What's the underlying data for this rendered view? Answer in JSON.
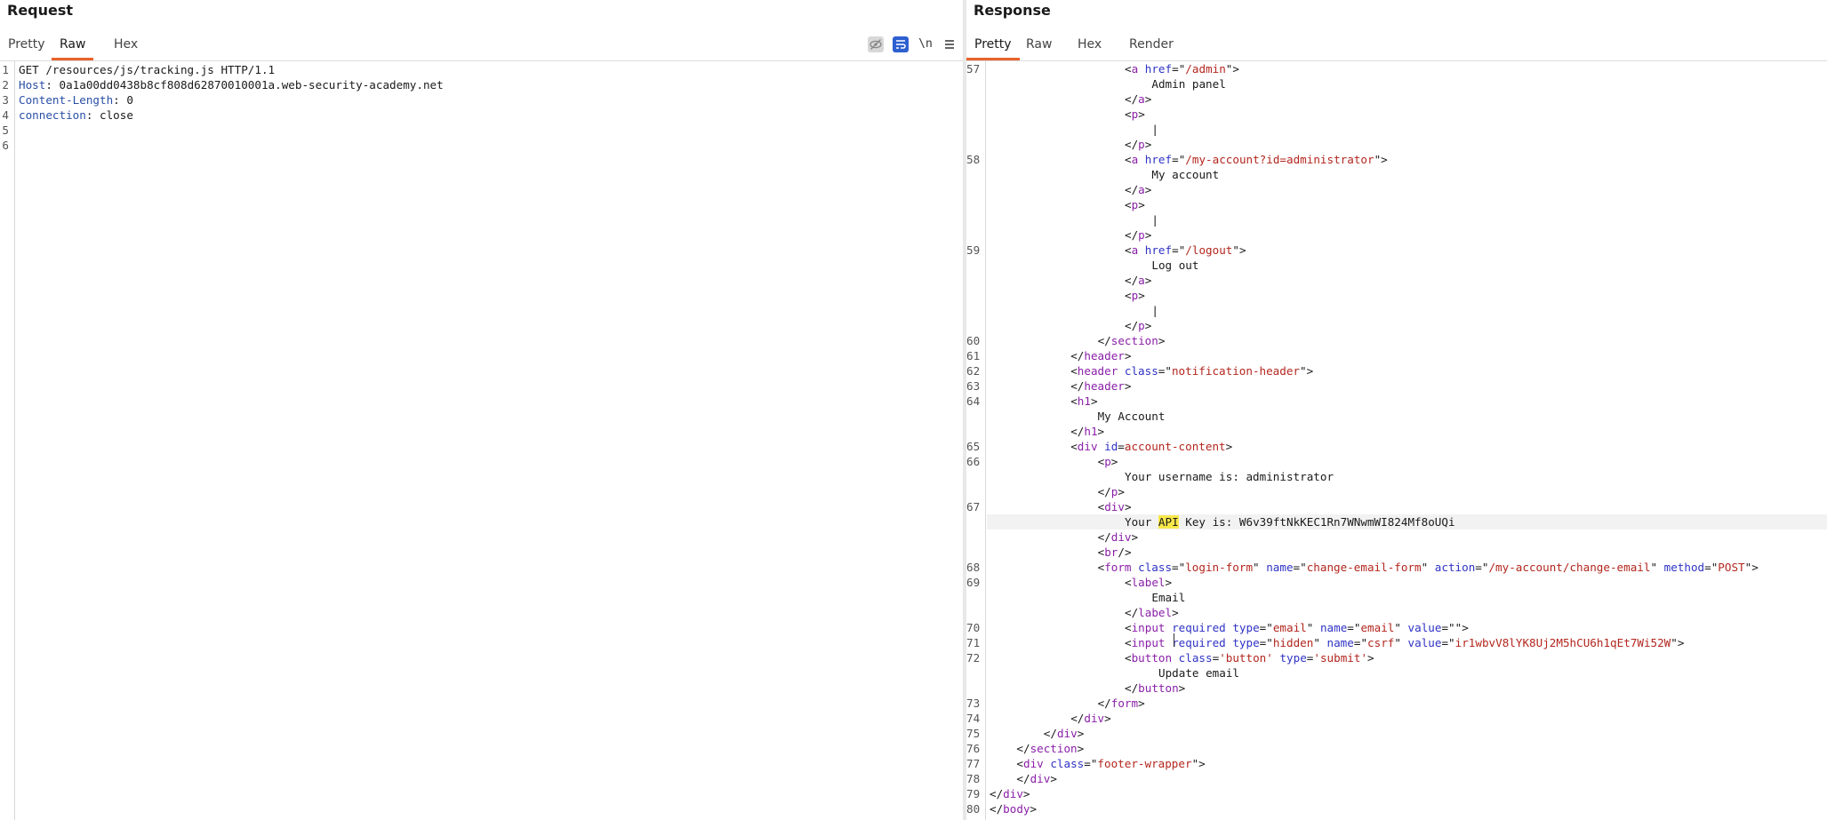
{
  "request": {
    "title": "Request",
    "tabs": [
      "Pretty",
      "Raw",
      "Hex"
    ],
    "active_tab": "Raw",
    "toolbar": {
      "hide_icon": "eye-slash-icon",
      "wrap_icon": "word-wrap-icon",
      "newline_label": "\\n",
      "menu_icon": "hamburger-menu-icon"
    },
    "lines": [
      {
        "n": "1",
        "tokens": [
          {
            "t": "GET /resources/js/tracking.js HTTP/1.1",
            "c": "plain"
          }
        ]
      },
      {
        "n": "2",
        "tokens": [
          {
            "t": "Host",
            "c": "hname"
          },
          {
            "t": ": 0a1a00dd0438b8cf808d62870010001a.web-security-academy.net",
            "c": "plain"
          }
        ]
      },
      {
        "n": "3",
        "tokens": [
          {
            "t": "Content-Length",
            "c": "hname"
          },
          {
            "t": ": 0",
            "c": "plain"
          }
        ]
      },
      {
        "n": "4",
        "tokens": [
          {
            "t": "connection",
            "c": "hname"
          },
          {
            "t": ": close",
            "c": "plain"
          }
        ]
      },
      {
        "n": "5",
        "tokens": []
      },
      {
        "n": "6",
        "tokens": []
      }
    ]
  },
  "response": {
    "title": "Response",
    "tabs": [
      "Pretty",
      "Raw",
      "Hex",
      "Render"
    ],
    "active_tab": "Pretty",
    "lines": [
      {
        "n": "57",
        "i": 20,
        "tokens": [
          {
            "t": "<",
            "c": "punc"
          },
          {
            "t": "a",
            "c": "tag"
          },
          {
            "t": " href",
            "c": "attr"
          },
          {
            "t": "=\"",
            "c": "punc"
          },
          {
            "t": "/admin",
            "c": "val"
          },
          {
            "t": "\">",
            "c": "punc"
          }
        ]
      },
      {
        "n": "",
        "i": 24,
        "tokens": [
          {
            "t": "Admin panel",
            "c": "plain"
          }
        ]
      },
      {
        "n": "",
        "i": 20,
        "tokens": [
          {
            "t": "</",
            "c": "punc"
          },
          {
            "t": "a",
            "c": "tag"
          },
          {
            "t": ">",
            "c": "punc"
          }
        ]
      },
      {
        "n": "",
        "i": 20,
        "tokens": [
          {
            "t": "<",
            "c": "punc"
          },
          {
            "t": "p",
            "c": "tag"
          },
          {
            "t": ">",
            "c": "punc"
          }
        ]
      },
      {
        "n": "",
        "i": 24,
        "tokens": [
          {
            "t": "|",
            "c": "plain"
          }
        ]
      },
      {
        "n": "",
        "i": 20,
        "tokens": [
          {
            "t": "</",
            "c": "punc"
          },
          {
            "t": "p",
            "c": "tag"
          },
          {
            "t": ">",
            "c": "punc"
          }
        ]
      },
      {
        "n": "58",
        "i": 20,
        "tokens": [
          {
            "t": "<",
            "c": "punc"
          },
          {
            "t": "a",
            "c": "tag"
          },
          {
            "t": " href",
            "c": "attr"
          },
          {
            "t": "=\"",
            "c": "punc"
          },
          {
            "t": "/my-account?id=administrator",
            "c": "val"
          },
          {
            "t": "\">",
            "c": "punc"
          }
        ]
      },
      {
        "n": "",
        "i": 24,
        "tokens": [
          {
            "t": "My account",
            "c": "plain"
          }
        ]
      },
      {
        "n": "",
        "i": 20,
        "tokens": [
          {
            "t": "</",
            "c": "punc"
          },
          {
            "t": "a",
            "c": "tag"
          },
          {
            "t": ">",
            "c": "punc"
          }
        ]
      },
      {
        "n": "",
        "i": 20,
        "tokens": [
          {
            "t": "<",
            "c": "punc"
          },
          {
            "t": "p",
            "c": "tag"
          },
          {
            "t": ">",
            "c": "punc"
          }
        ]
      },
      {
        "n": "",
        "i": 24,
        "tokens": [
          {
            "t": "|",
            "c": "plain"
          }
        ]
      },
      {
        "n": "",
        "i": 20,
        "tokens": [
          {
            "t": "</",
            "c": "punc"
          },
          {
            "t": "p",
            "c": "tag"
          },
          {
            "t": ">",
            "c": "punc"
          }
        ]
      },
      {
        "n": "59",
        "i": 20,
        "tokens": [
          {
            "t": "<",
            "c": "punc"
          },
          {
            "t": "a",
            "c": "tag"
          },
          {
            "t": " href",
            "c": "attr"
          },
          {
            "t": "=\"",
            "c": "punc"
          },
          {
            "t": "/logout",
            "c": "val"
          },
          {
            "t": "\">",
            "c": "punc"
          }
        ]
      },
      {
        "n": "",
        "i": 24,
        "tokens": [
          {
            "t": "Log out",
            "c": "plain"
          }
        ]
      },
      {
        "n": "",
        "i": 20,
        "tokens": [
          {
            "t": "</",
            "c": "punc"
          },
          {
            "t": "a",
            "c": "tag"
          },
          {
            "t": ">",
            "c": "punc"
          }
        ]
      },
      {
        "n": "",
        "i": 20,
        "tokens": [
          {
            "t": "<",
            "c": "punc"
          },
          {
            "t": "p",
            "c": "tag"
          },
          {
            "t": ">",
            "c": "punc"
          }
        ]
      },
      {
        "n": "",
        "i": 24,
        "tokens": [
          {
            "t": "|",
            "c": "plain"
          }
        ]
      },
      {
        "n": "",
        "i": 20,
        "tokens": [
          {
            "t": "</",
            "c": "punc"
          },
          {
            "t": "p",
            "c": "tag"
          },
          {
            "t": ">",
            "c": "punc"
          }
        ]
      },
      {
        "n": "60",
        "i": 16,
        "tokens": [
          {
            "t": "</",
            "c": "punc"
          },
          {
            "t": "section",
            "c": "tag"
          },
          {
            "t": ">",
            "c": "punc"
          }
        ]
      },
      {
        "n": "61",
        "i": 12,
        "tokens": [
          {
            "t": "</",
            "c": "punc"
          },
          {
            "t": "header",
            "c": "tag"
          },
          {
            "t": ">",
            "c": "punc"
          }
        ]
      },
      {
        "n": "62",
        "i": 12,
        "tokens": [
          {
            "t": "<",
            "c": "punc"
          },
          {
            "t": "header",
            "c": "tag"
          },
          {
            "t": " class",
            "c": "attr"
          },
          {
            "t": "=\"",
            "c": "punc"
          },
          {
            "t": "notification-header",
            "c": "val"
          },
          {
            "t": "\">",
            "c": "punc"
          }
        ]
      },
      {
        "n": "63",
        "i": 12,
        "tokens": [
          {
            "t": "</",
            "c": "punc"
          },
          {
            "t": "header",
            "c": "tag"
          },
          {
            "t": ">",
            "c": "punc"
          }
        ]
      },
      {
        "n": "64",
        "i": 12,
        "tokens": [
          {
            "t": "<",
            "c": "punc"
          },
          {
            "t": "h1",
            "c": "tag"
          },
          {
            "t": ">",
            "c": "punc"
          }
        ]
      },
      {
        "n": "",
        "i": 16,
        "tokens": [
          {
            "t": "My Account",
            "c": "plain"
          }
        ]
      },
      {
        "n": "",
        "i": 12,
        "tokens": [
          {
            "t": "</",
            "c": "punc"
          },
          {
            "t": "h1",
            "c": "tag"
          },
          {
            "t": ">",
            "c": "punc"
          }
        ]
      },
      {
        "n": "65",
        "i": 12,
        "tokens": [
          {
            "t": "<",
            "c": "punc"
          },
          {
            "t": "div",
            "c": "tag"
          },
          {
            "t": " id",
            "c": "attr"
          },
          {
            "t": "=",
            "c": "punc"
          },
          {
            "t": "account-content",
            "c": "val"
          },
          {
            "t": ">",
            "c": "punc"
          }
        ]
      },
      {
        "n": "66",
        "i": 16,
        "tokens": [
          {
            "t": "<",
            "c": "punc"
          },
          {
            "t": "p",
            "c": "tag"
          },
          {
            "t": ">",
            "c": "punc"
          }
        ]
      },
      {
        "n": "",
        "i": 20,
        "tokens": [
          {
            "t": "Your username is: administrator",
            "c": "plain"
          }
        ]
      },
      {
        "n": "",
        "i": 16,
        "tokens": [
          {
            "t": "</",
            "c": "punc"
          },
          {
            "t": "p",
            "c": "tag"
          },
          {
            "t": ">",
            "c": "punc"
          }
        ]
      },
      {
        "n": "67",
        "i": 16,
        "tokens": [
          {
            "t": "<",
            "c": "punc"
          },
          {
            "t": "div",
            "c": "tag"
          },
          {
            "t": ">",
            "c": "punc"
          }
        ]
      },
      {
        "n": "",
        "i": 20,
        "hl": true,
        "tokens": [
          {
            "t": "Your ",
            "c": "plain"
          },
          {
            "t": "API",
            "c": "mark"
          },
          {
            "t": " Key is: W6v39ftNkKEC1Rn7WNwmWI824Mf8oUQi",
            "c": "plain"
          }
        ]
      },
      {
        "n": "",
        "i": 16,
        "tokens": [
          {
            "t": "</",
            "c": "punc"
          },
          {
            "t": "div",
            "c": "tag"
          },
          {
            "t": ">",
            "c": "punc"
          }
        ]
      },
      {
        "n": "",
        "i": 16,
        "tokens": [
          {
            "t": "<",
            "c": "punc"
          },
          {
            "t": "br",
            "c": "tag"
          },
          {
            "t": "/>",
            "c": "punc"
          }
        ]
      },
      {
        "n": "68",
        "i": 16,
        "tokens": [
          {
            "t": "<",
            "c": "punc"
          },
          {
            "t": "form",
            "c": "tag"
          },
          {
            "t": " class",
            "c": "attr"
          },
          {
            "t": "=\"",
            "c": "punc"
          },
          {
            "t": "login-form",
            "c": "val"
          },
          {
            "t": "\"",
            "c": "punc"
          },
          {
            "t": " name",
            "c": "attr"
          },
          {
            "t": "=\"",
            "c": "punc"
          },
          {
            "t": "change-email-form",
            "c": "val"
          },
          {
            "t": "\"",
            "c": "punc"
          },
          {
            "t": " action",
            "c": "attr"
          },
          {
            "t": "=\"",
            "c": "punc"
          },
          {
            "t": "/my-account/change-email",
            "c": "val"
          },
          {
            "t": "\"",
            "c": "punc"
          },
          {
            "t": " method",
            "c": "attr"
          },
          {
            "t": "=\"",
            "c": "punc"
          },
          {
            "t": "POST",
            "c": "val"
          },
          {
            "t": "\">",
            "c": "punc"
          }
        ]
      },
      {
        "n": "69",
        "i": 20,
        "tokens": [
          {
            "t": "<",
            "c": "punc"
          },
          {
            "t": "label",
            "c": "tag"
          },
          {
            "t": ">",
            "c": "punc"
          }
        ]
      },
      {
        "n": "",
        "i": 24,
        "tokens": [
          {
            "t": "Email",
            "c": "plain"
          }
        ]
      },
      {
        "n": "",
        "i": 20,
        "tokens": [
          {
            "t": "</",
            "c": "punc"
          },
          {
            "t": "label",
            "c": "tag"
          },
          {
            "t": ">",
            "c": "punc"
          }
        ]
      },
      {
        "n": "70",
        "i": 20,
        "tokens": [
          {
            "t": "<",
            "c": "punc"
          },
          {
            "t": "input",
            "c": "tag"
          },
          {
            "t": " required type",
            "c": "attr"
          },
          {
            "t": "=\"",
            "c": "punc"
          },
          {
            "t": "email",
            "c": "val"
          },
          {
            "t": "\"",
            "c": "punc"
          },
          {
            "t": " name",
            "c": "attr"
          },
          {
            "t": "=\"",
            "c": "punc"
          },
          {
            "t": "email",
            "c": "val"
          },
          {
            "t": "\"",
            "c": "punc"
          },
          {
            "t": " value",
            "c": "attr"
          },
          {
            "t": "=\"\">",
            "c": "punc"
          }
        ]
      },
      {
        "n": "71",
        "i": 20,
        "tokens": [
          {
            "t": "<",
            "c": "punc"
          },
          {
            "t": "input",
            "c": "tag"
          },
          {
            "t": " required type",
            "c": "attr"
          },
          {
            "t": "=\"",
            "c": "punc"
          },
          {
            "t": "hidden",
            "c": "val"
          },
          {
            "t": "\"",
            "c": "punc"
          },
          {
            "t": " name",
            "c": "attr"
          },
          {
            "t": "=\"",
            "c": "punc"
          },
          {
            "t": "csrf",
            "c": "val"
          },
          {
            "t": "\"",
            "c": "punc"
          },
          {
            "t": " value",
            "c": "attr"
          },
          {
            "t": "=\"",
            "c": "punc"
          },
          {
            "t": "ir1wbvV8lYK8Uj2M5hCU6h1qEt7Wi52W",
            "c": "val"
          },
          {
            "t": "\">",
            "c": "punc"
          }
        ]
      },
      {
        "n": "72",
        "i": 20,
        "tokens": [
          {
            "t": "<",
            "c": "punc"
          },
          {
            "t": "button",
            "c": "tag"
          },
          {
            "t": " class",
            "c": "attr"
          },
          {
            "t": "=",
            "c": "punc"
          },
          {
            "t": "'button'",
            "c": "val"
          },
          {
            "t": " type",
            "c": "attr"
          },
          {
            "t": "=",
            "c": "punc"
          },
          {
            "t": "'submit'",
            "c": "val"
          },
          {
            "t": ">",
            "c": "punc"
          }
        ]
      },
      {
        "n": "",
        "i": 25,
        "tokens": [
          {
            "t": "Update email",
            "c": "plain"
          }
        ]
      },
      {
        "n": "",
        "i": 20,
        "tokens": [
          {
            "t": "</",
            "c": "punc"
          },
          {
            "t": "button",
            "c": "tag"
          },
          {
            "t": ">",
            "c": "punc"
          }
        ]
      },
      {
        "n": "73",
        "i": 16,
        "tokens": [
          {
            "t": "</",
            "c": "punc"
          },
          {
            "t": "form",
            "c": "tag"
          },
          {
            "t": ">",
            "c": "punc"
          }
        ]
      },
      {
        "n": "74",
        "i": 12,
        "tokens": [
          {
            "t": "</",
            "c": "punc"
          },
          {
            "t": "div",
            "c": "tag"
          },
          {
            "t": ">",
            "c": "punc"
          }
        ]
      },
      {
        "n": "75",
        "i": 8,
        "tokens": [
          {
            "t": "</",
            "c": "punc"
          },
          {
            "t": "div",
            "c": "tag"
          },
          {
            "t": ">",
            "c": "punc"
          }
        ]
      },
      {
        "n": "76",
        "i": 4,
        "tokens": [
          {
            "t": "</",
            "c": "punc"
          },
          {
            "t": "section",
            "c": "tag"
          },
          {
            "t": ">",
            "c": "punc"
          }
        ]
      },
      {
        "n": "77",
        "i": 4,
        "tokens": [
          {
            "t": "<",
            "c": "punc"
          },
          {
            "t": "div",
            "c": "tag"
          },
          {
            "t": " class",
            "c": "attr"
          },
          {
            "t": "=\"",
            "c": "punc"
          },
          {
            "t": "footer-wrapper",
            "c": "val"
          },
          {
            "t": "\">",
            "c": "punc"
          }
        ]
      },
      {
        "n": "78",
        "i": 4,
        "tokens": [
          {
            "t": "</",
            "c": "punc"
          },
          {
            "t": "div",
            "c": "tag"
          },
          {
            "t": ">",
            "c": "punc"
          }
        ]
      },
      {
        "n": "79",
        "i": 0,
        "tokens": [
          {
            "t": "</",
            "c": "punc"
          },
          {
            "t": "div",
            "c": "tag"
          },
          {
            "t": ">",
            "c": "punc"
          }
        ]
      },
      {
        "n": "80",
        "i": 0,
        "tokens": [
          {
            "t": "</",
            "c": "punc"
          },
          {
            "t": "body",
            "c": "tag"
          },
          {
            "t": ">",
            "c": "punc"
          }
        ]
      }
    ]
  },
  "colors": {
    "accent": "#e8622a",
    "tag": "#8a1fa8",
    "attribute": "#2f33c4",
    "value": "#b3261e",
    "highlight": "#f7e84a"
  }
}
